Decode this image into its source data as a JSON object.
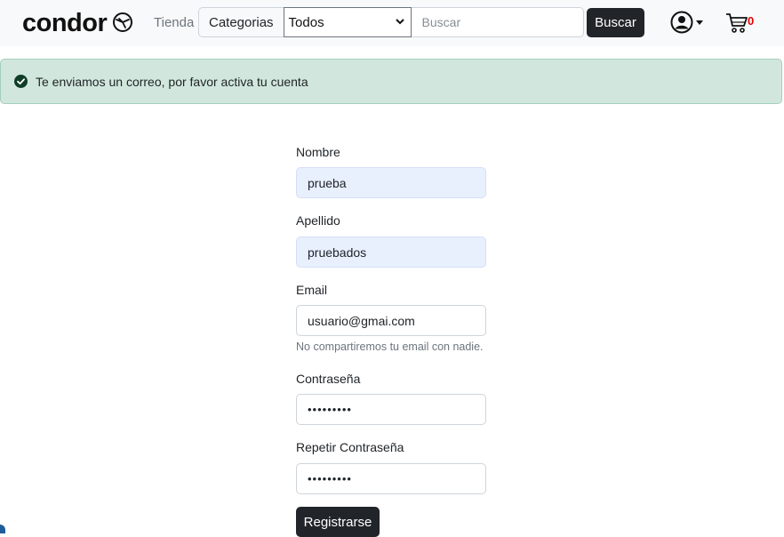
{
  "navbar": {
    "brand": "condor",
    "brand_icon": "plane-circle-icon",
    "store_link": "Tienda",
    "category_label": "Categorias",
    "category_selected": "Todos",
    "search_placeholder": "Buscar",
    "search_button": "Buscar",
    "user_icon": "user-circle-icon",
    "cart_icon": "cart-icon",
    "cart_count": "0",
    "cart_count_color": "#e60000"
  },
  "alert": {
    "message": "Te enviamos un correo, por favor activa tu cuenta",
    "icon": "check-circle-icon",
    "background": "#d1e7dd"
  },
  "form": {
    "first_name": {
      "label": "Nombre",
      "value": "prueba"
    },
    "last_name": {
      "label": "Apellido",
      "value": "pruebados"
    },
    "email": {
      "label": "Email",
      "value": "usuario@gmai.com",
      "help": "No compartiremos tu email con nadie."
    },
    "password": {
      "label": "Contraseña",
      "value": "•••••••••"
    },
    "password_repeat": {
      "label": "Repetir Contraseña",
      "value": "•••••••••"
    },
    "submit": "Registrarse"
  }
}
